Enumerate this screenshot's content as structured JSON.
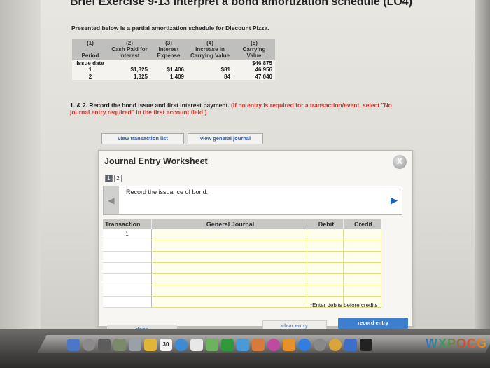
{
  "page": {
    "title": "Brief Exercise 9-13 Interpret a bond amortization schedule (LO4)",
    "intro": "Presented below is a partial amortization schedule for Discount Pizza."
  },
  "schedule": {
    "headers": [
      {
        "num": "(1)",
        "label": "Period"
      },
      {
        "num": "(2)",
        "label": "Cash Paid for Interest"
      },
      {
        "num": "(3)",
        "label": "Interest Expense"
      },
      {
        "num": "(4)",
        "label": "Increase in Carrying Value"
      },
      {
        "num": "(5)",
        "label": "Carrying Value"
      }
    ],
    "rows": [
      {
        "period": "Issue date",
        "cash": "",
        "expense": "",
        "increase": "",
        "carrying": "$46,875"
      },
      {
        "period": "1",
        "cash": "$1,325",
        "expense": "$1,406",
        "increase": "$81",
        "carrying": "46,956"
      },
      {
        "period": "2",
        "cash": "1,325",
        "expense": "1,409",
        "increase": "84",
        "carrying": "47,040"
      }
    ]
  },
  "instructions": {
    "main": "1. & 2. Record the bond issue and first interest payment.",
    "note": "(If no entry is required for a transaction/event, select \"No journal entry required\" in the first account field.)"
  },
  "buttons": {
    "view_transaction_list": "view transaction list",
    "view_general_journal": "view general journal"
  },
  "worksheet": {
    "title": "Journal Entry Worksheet",
    "close": "X",
    "steps": [
      "1",
      "2"
    ],
    "prev": "◀",
    "next": "▶",
    "record_text": "Record the issuance of bond.",
    "columns": {
      "transaction": "Transaction",
      "general_journal": "General Journal",
      "debit": "Debit",
      "credit": "Credit"
    },
    "first_transaction": "1",
    "hint": "*Enter debits before credits",
    "done": "done",
    "clear_entry": "clear entry",
    "record_entry": "record entry"
  },
  "dock": {
    "calendar_day": "30",
    "tail_text": "WXPOCG"
  }
}
